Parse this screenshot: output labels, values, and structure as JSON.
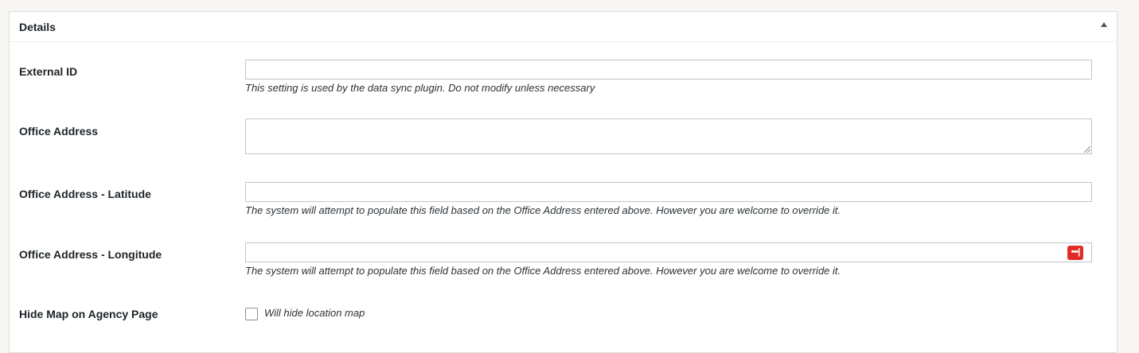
{
  "panel": {
    "title": "Details",
    "toggle_icon": "triangle-up-icon"
  },
  "fields": {
    "external_id": {
      "label": "External ID",
      "value": "",
      "description": "This setting is used by the data sync plugin. Do not modify unless necessary"
    },
    "office_address": {
      "label": "Office Address",
      "value": ""
    },
    "latitude": {
      "label": "Office Address - Latitude",
      "value": "",
      "description": "The system will attempt to populate this field based on the Office Address entered above. However you are welcome to override it."
    },
    "longitude": {
      "label": "Office Address - Longitude",
      "value": "",
      "description": "The system will attempt to populate this field based on the Office Address entered above. However you are welcome to override it.",
      "icon": "password-manager-icon",
      "icon_glyph": "•••|",
      "icon_color": "#e02b27"
    },
    "hide_map": {
      "label": "Hide Map on Agency Page",
      "checked": false,
      "checkbox_label": "Will hide location map"
    }
  }
}
